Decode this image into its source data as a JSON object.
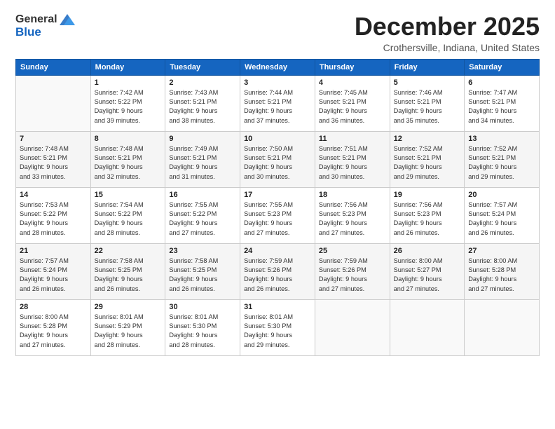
{
  "logo": {
    "general": "General",
    "blue": "Blue"
  },
  "title": "December 2025",
  "location": "Crothersville, Indiana, United States",
  "days_of_week": [
    "Sunday",
    "Monday",
    "Tuesday",
    "Wednesday",
    "Thursday",
    "Friday",
    "Saturday"
  ],
  "weeks": [
    [
      {
        "day": "",
        "info": ""
      },
      {
        "day": "1",
        "info": "Sunrise: 7:42 AM\nSunset: 5:22 PM\nDaylight: 9 hours\nand 39 minutes."
      },
      {
        "day": "2",
        "info": "Sunrise: 7:43 AM\nSunset: 5:21 PM\nDaylight: 9 hours\nand 38 minutes."
      },
      {
        "day": "3",
        "info": "Sunrise: 7:44 AM\nSunset: 5:21 PM\nDaylight: 9 hours\nand 37 minutes."
      },
      {
        "day": "4",
        "info": "Sunrise: 7:45 AM\nSunset: 5:21 PM\nDaylight: 9 hours\nand 36 minutes."
      },
      {
        "day": "5",
        "info": "Sunrise: 7:46 AM\nSunset: 5:21 PM\nDaylight: 9 hours\nand 35 minutes."
      },
      {
        "day": "6",
        "info": "Sunrise: 7:47 AM\nSunset: 5:21 PM\nDaylight: 9 hours\nand 34 minutes."
      }
    ],
    [
      {
        "day": "7",
        "info": "Sunrise: 7:48 AM\nSunset: 5:21 PM\nDaylight: 9 hours\nand 33 minutes."
      },
      {
        "day": "8",
        "info": "Sunrise: 7:48 AM\nSunset: 5:21 PM\nDaylight: 9 hours\nand 32 minutes."
      },
      {
        "day": "9",
        "info": "Sunrise: 7:49 AM\nSunset: 5:21 PM\nDaylight: 9 hours\nand 31 minutes."
      },
      {
        "day": "10",
        "info": "Sunrise: 7:50 AM\nSunset: 5:21 PM\nDaylight: 9 hours\nand 30 minutes."
      },
      {
        "day": "11",
        "info": "Sunrise: 7:51 AM\nSunset: 5:21 PM\nDaylight: 9 hours\nand 30 minutes."
      },
      {
        "day": "12",
        "info": "Sunrise: 7:52 AM\nSunset: 5:21 PM\nDaylight: 9 hours\nand 29 minutes."
      },
      {
        "day": "13",
        "info": "Sunrise: 7:52 AM\nSunset: 5:21 PM\nDaylight: 9 hours\nand 29 minutes."
      }
    ],
    [
      {
        "day": "14",
        "info": "Sunrise: 7:53 AM\nSunset: 5:22 PM\nDaylight: 9 hours\nand 28 minutes."
      },
      {
        "day": "15",
        "info": "Sunrise: 7:54 AM\nSunset: 5:22 PM\nDaylight: 9 hours\nand 28 minutes."
      },
      {
        "day": "16",
        "info": "Sunrise: 7:55 AM\nSunset: 5:22 PM\nDaylight: 9 hours\nand 27 minutes."
      },
      {
        "day": "17",
        "info": "Sunrise: 7:55 AM\nSunset: 5:23 PM\nDaylight: 9 hours\nand 27 minutes."
      },
      {
        "day": "18",
        "info": "Sunrise: 7:56 AM\nSunset: 5:23 PM\nDaylight: 9 hours\nand 27 minutes."
      },
      {
        "day": "19",
        "info": "Sunrise: 7:56 AM\nSunset: 5:23 PM\nDaylight: 9 hours\nand 26 minutes."
      },
      {
        "day": "20",
        "info": "Sunrise: 7:57 AM\nSunset: 5:24 PM\nDaylight: 9 hours\nand 26 minutes."
      }
    ],
    [
      {
        "day": "21",
        "info": "Sunrise: 7:57 AM\nSunset: 5:24 PM\nDaylight: 9 hours\nand 26 minutes."
      },
      {
        "day": "22",
        "info": "Sunrise: 7:58 AM\nSunset: 5:25 PM\nDaylight: 9 hours\nand 26 minutes."
      },
      {
        "day": "23",
        "info": "Sunrise: 7:58 AM\nSunset: 5:25 PM\nDaylight: 9 hours\nand 26 minutes."
      },
      {
        "day": "24",
        "info": "Sunrise: 7:59 AM\nSunset: 5:26 PM\nDaylight: 9 hours\nand 26 minutes."
      },
      {
        "day": "25",
        "info": "Sunrise: 7:59 AM\nSunset: 5:26 PM\nDaylight: 9 hours\nand 27 minutes."
      },
      {
        "day": "26",
        "info": "Sunrise: 8:00 AM\nSunset: 5:27 PM\nDaylight: 9 hours\nand 27 minutes."
      },
      {
        "day": "27",
        "info": "Sunrise: 8:00 AM\nSunset: 5:28 PM\nDaylight: 9 hours\nand 27 minutes."
      }
    ],
    [
      {
        "day": "28",
        "info": "Sunrise: 8:00 AM\nSunset: 5:28 PM\nDaylight: 9 hours\nand 27 minutes."
      },
      {
        "day": "29",
        "info": "Sunrise: 8:01 AM\nSunset: 5:29 PM\nDaylight: 9 hours\nand 28 minutes."
      },
      {
        "day": "30",
        "info": "Sunrise: 8:01 AM\nSunset: 5:30 PM\nDaylight: 9 hours\nand 28 minutes."
      },
      {
        "day": "31",
        "info": "Sunrise: 8:01 AM\nSunset: 5:30 PM\nDaylight: 9 hours\nand 29 minutes."
      },
      {
        "day": "",
        "info": ""
      },
      {
        "day": "",
        "info": ""
      },
      {
        "day": "",
        "info": ""
      }
    ]
  ]
}
